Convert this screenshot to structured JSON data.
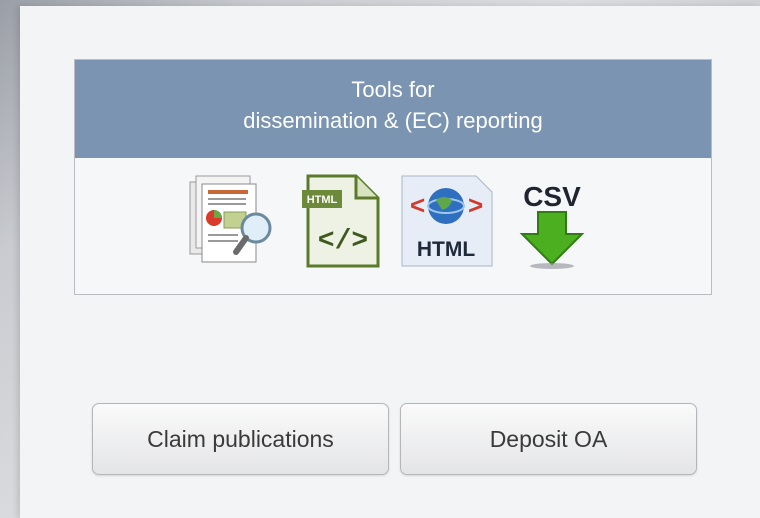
{
  "tools": {
    "title_line1": "Tools for",
    "title_line2": "dissemination & (EC) reporting",
    "icons": [
      "report-preview-icon",
      "html-code-icon",
      "html-globe-icon",
      "csv-download-icon"
    ],
    "icon_labels": {
      "html_code_badge": "HTML",
      "html_code_tag": "</>",
      "html_globe_text": "HTML",
      "csv_text": "CSV"
    }
  },
  "actions": {
    "claim_label": "Claim publications",
    "deposit_label": "Deposit OA"
  },
  "colors": {
    "header_bg": "#7b94b2",
    "panel_bg": "#f3f4f6",
    "csv_arrow": "#4caf20",
    "code_green": "#5b7a2a"
  }
}
